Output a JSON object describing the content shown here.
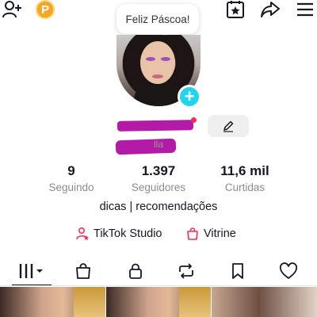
{
  "header": {
    "note_text": "Feliz Páscoa!",
    "coin_label": "P",
    "icons": [
      "add-user-icon",
      "coin-icon",
      "favorites-icon",
      "share-icon",
      "menu-icon"
    ]
  },
  "profile": {
    "username_visible_fragment": "lla",
    "add_button_label": "+"
  },
  "stats": {
    "following_count": "9",
    "following_label": "Seguindo",
    "followers_count": "1.397",
    "followers_label": "Seguidores",
    "likes_count": "11,6 mil",
    "likes_label": "Curtidas"
  },
  "bio": "dicas | recomendações",
  "links": {
    "studio_label": "TikTok Studio",
    "showcase_label": "Vitrine"
  },
  "tabs": [
    "videos-grid-icon",
    "shop-bag-icon",
    "lock-icon",
    "repost-icon",
    "bookmark-icon",
    "heart-icon"
  ],
  "colors": {
    "accent_red": "#fe2c55",
    "add_button": "#20d5ec",
    "coin": "#f5a623",
    "redaction": "#b21aa7"
  }
}
